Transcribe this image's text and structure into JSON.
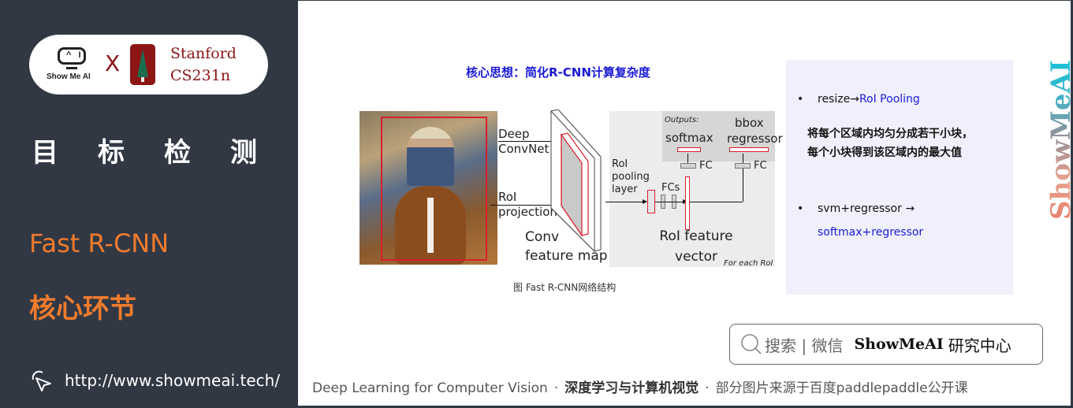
{
  "sidebar": {
    "logo": {
      "showmeai_face": "^ I",
      "showmeai_text": "Show Me AI",
      "cross": "X",
      "stanford_line1": "Stanford",
      "stanford_line2": "CS231n"
    },
    "section_title": "目标检测",
    "subtitle_en": "Fast R-CNN",
    "subtitle_cn": "核心环节",
    "url": "http://www.showmeai.tech/"
  },
  "slide": {
    "title": "核心思想：简化R-CNN计算复杂度",
    "diagram": {
      "deep_convnet_1": "Deep",
      "deep_convnet_2": "ConvNet",
      "roi_projection_1": "RoI",
      "roi_projection_2": "projection",
      "conv_map_1": "Conv",
      "conv_map_2": "feature map",
      "roi_pool_1": "RoI",
      "roi_pool_2": "pooling",
      "roi_pool_3": "layer",
      "fcs": "FCs",
      "outputs": "Outputs:",
      "softmax": "softmax",
      "bbox_1": "bbox",
      "bbox_2": "regressor",
      "fc_left": "FC",
      "fc_right": "FC",
      "roi_vec_1": "RoI feature",
      "roi_vec_2": "vector",
      "for_each": "For each RoI"
    },
    "caption": "图 Fast R-CNN网络结构",
    "bullets": [
      {
        "prefix": "resize→",
        "highlight": "RoI Pooling"
      },
      {
        "prefix": "svm+regressor →",
        "highlight": "softmax+regressor"
      }
    ],
    "desc_line1": "将每个区域内均匀分成若干小块，",
    "desc_line2": "每个小块得到该区域内的最大值",
    "watermark": "ShowMeAI",
    "bullet_symbol": "•"
  },
  "search": {
    "hint": "搜索 | 微信",
    "brand": "ShowMeAI",
    "brand_cn": "研究中心"
  },
  "footer": {
    "part1": "Deep Learning for Computer Vision",
    "sep": "·",
    "part2": "深度学习与计算机视觉",
    "part3": "部分图片来源于百度paddlepaddle公开课"
  },
  "colors": {
    "sidebar_bg": "#313844",
    "accent_orange": "#f07b2d",
    "stanford_red": "#8c1515",
    "highlight_blue": "#1a1ad6",
    "box_bg": "#eff0fb"
  }
}
